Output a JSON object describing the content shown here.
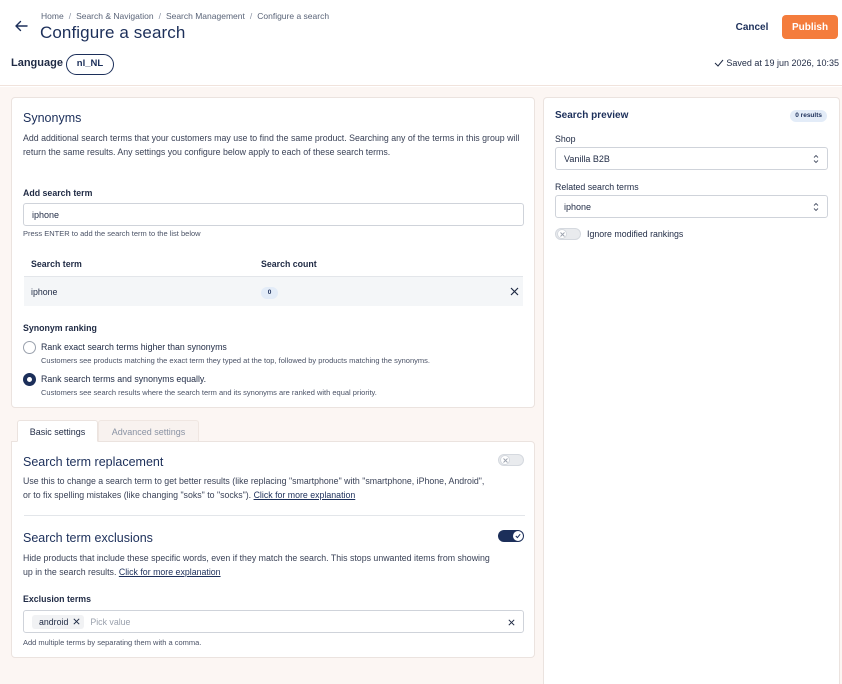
{
  "header": {
    "breadcrumbs": [
      "Home",
      "Search & Navigation",
      "Search Management",
      "Configure a search"
    ],
    "breadcrumb_sep": "/",
    "title": "Configure a search",
    "cancel_label": "Cancel",
    "publish_label": "Publish",
    "language_label": "Language",
    "language_value": "nl_NL",
    "saved_text": "Saved at 19 jun 2026, 10:35"
  },
  "synonyms": {
    "title": "Synonyms",
    "description": "Add additional search terms that your customers may use to find the same product. Searching any of the terms in this group will return the same results. Any settings you configure below apply to each of these search terms.",
    "add_label": "Add search term",
    "add_value": "iphone",
    "add_hint": "Press ENTER to add the search term to the list below",
    "table": {
      "columns": [
        "Search term",
        "Search count"
      ],
      "rows": [
        {
          "term": "iphone",
          "count": "0"
        }
      ]
    },
    "ranking_label": "Synonym ranking",
    "ranking_options": [
      {
        "label": "Rank exact search terms higher than synonyms",
        "hint": "Customers see products matching the exact term they typed at the top, followed by products matching the synonyms.",
        "selected": false
      },
      {
        "label": "Rank search terms and synonyms equally.",
        "hint": "Customers see search results where the search term and its synonyms are ranked with equal priority.",
        "selected": true
      }
    ]
  },
  "tabs": [
    {
      "label": "Basic settings",
      "active": true
    },
    {
      "label": "Advanced settings",
      "active": false
    }
  ],
  "replacement": {
    "title": "Search term replacement",
    "description": "Use this to change a search term to get better results (like replacing \"smartphone\" with \"smartphone, iPhone, Android\", or to fix spelling mistakes (like changing \"soks\" to \"socks\").",
    "link": "Click for more explanation",
    "enabled": false
  },
  "exclusions": {
    "title": "Search term exclusions",
    "description": "Hide products that include these specific words, even if they match the search. This stops unwanted items from showing up in the search results.",
    "link": "Click for more explanation",
    "enabled": true,
    "terms_label": "Exclusion terms",
    "chips": [
      "android"
    ],
    "placeholder": "Pick value",
    "hint": "Add multiple terms by separating them with a comma."
  },
  "preview": {
    "title": "Search preview",
    "results_badge": "0 results",
    "shop_label": "Shop",
    "shop_value": "Vanilla B2B",
    "related_label": "Related search terms",
    "related_value": "iphone",
    "ignore_label": "Ignore modified rankings",
    "ignore_enabled": false
  },
  "colors": {
    "accent": "#f47c3c",
    "primary": "#1c2f5a",
    "background": "#fcf6f3"
  }
}
